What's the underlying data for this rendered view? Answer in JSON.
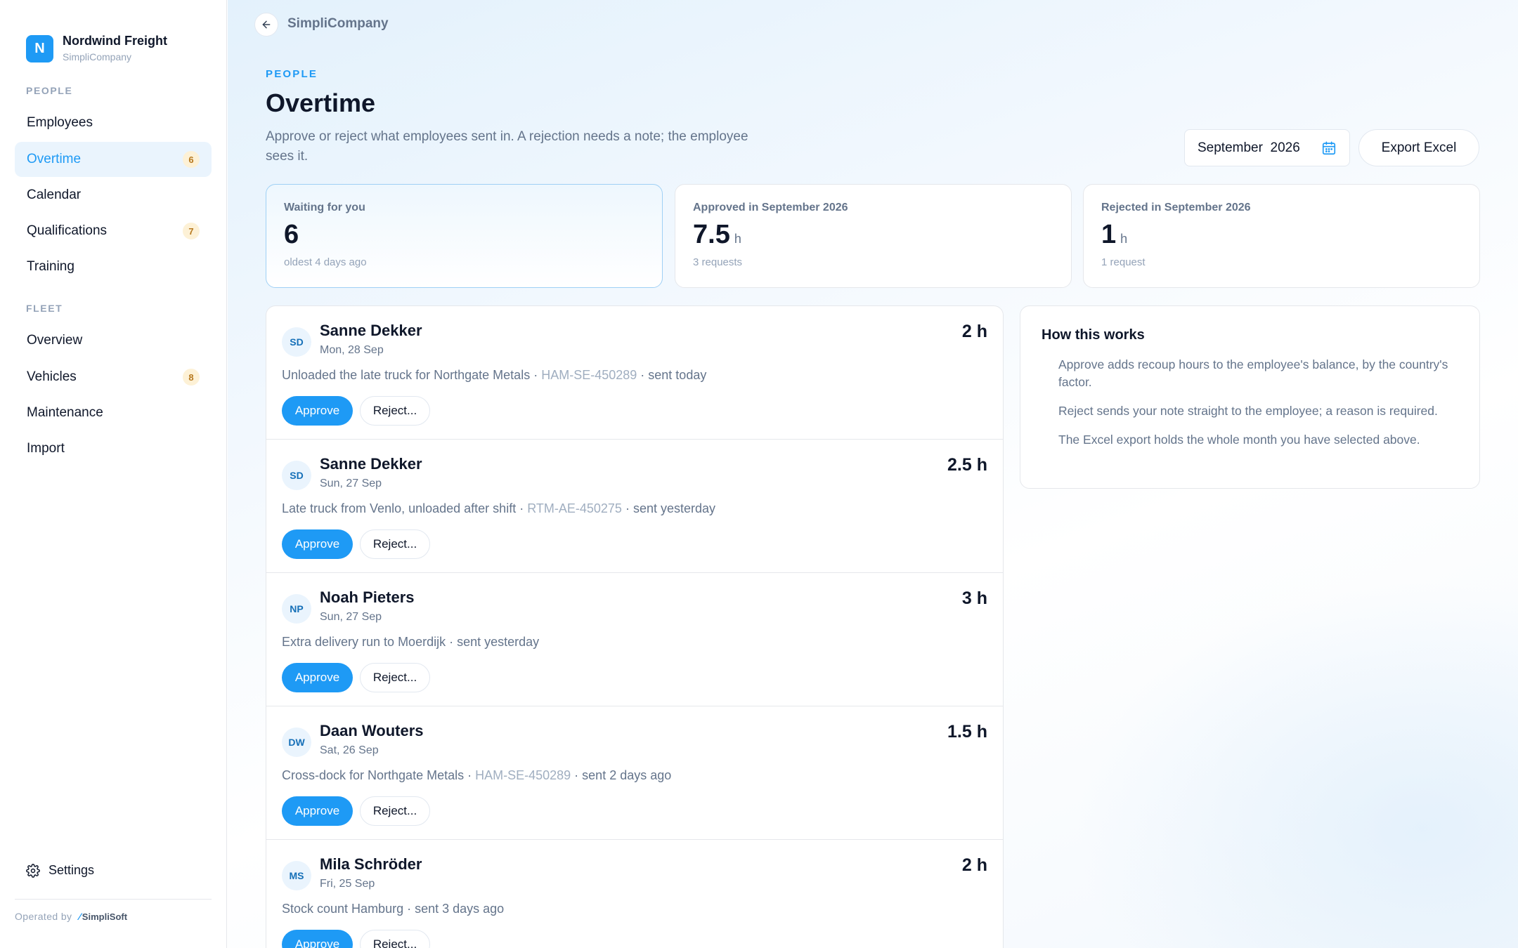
{
  "org": {
    "initial": "N",
    "name": "Nordwind Freight",
    "sub": "SimpliCompany"
  },
  "nav": {
    "people_title": "PEOPLE",
    "people": [
      {
        "label": "Employees",
        "badge": ""
      },
      {
        "label": "Overtime",
        "badge": "6"
      },
      {
        "label": "Calendar",
        "badge": ""
      },
      {
        "label": "Qualifications",
        "badge": "7"
      },
      {
        "label": "Training",
        "badge": ""
      }
    ],
    "fleet_title": "FLEET",
    "fleet": [
      {
        "label": "Overview",
        "badge": ""
      },
      {
        "label": "Vehicles",
        "badge": "8"
      },
      {
        "label": "Maintenance",
        "badge": ""
      },
      {
        "label": "Import",
        "badge": ""
      }
    ],
    "settings": "Settings",
    "operated_by": "Operated by",
    "brand": "SimpliSoft"
  },
  "header": {
    "breadcrumb": "SimpliCompany",
    "eyebrow": "PEOPLE",
    "title": "Overtime",
    "description": "Approve or reject what employees sent in. A rejection needs a note; the employee sees it.",
    "month": "September",
    "year": "2026",
    "export": "Export Excel"
  },
  "stats": [
    {
      "label": "Waiting for you",
      "value": "6",
      "unit": "",
      "note": "oldest 4 days ago"
    },
    {
      "label": "Approved in September 2026",
      "value": "7.5",
      "unit": "h",
      "note": "3 requests"
    },
    {
      "label": "Rejected in September 2026",
      "value": "1",
      "unit": "h",
      "note": "1 request"
    }
  ],
  "requests": [
    {
      "initials": "SD",
      "name": "Sanne Dekker",
      "date": "Mon, 28 Sep",
      "hours": "2 h",
      "desc": "Unloaded the late truck for Northgate Metals",
      "ref": "HAM-SE-450289",
      "sent": "sent today"
    },
    {
      "initials": "SD",
      "name": "Sanne Dekker",
      "date": "Sun, 27 Sep",
      "hours": "2.5 h",
      "desc": "Late truck from Venlo, unloaded after shift",
      "ref": "RTM-AE-450275",
      "sent": "sent yesterday"
    },
    {
      "initials": "NP",
      "name": "Noah Pieters",
      "date": "Sun, 27 Sep",
      "hours": "3 h",
      "desc": "Extra delivery run to Moerdijk",
      "ref": "",
      "sent": "sent yesterday"
    },
    {
      "initials": "DW",
      "name": "Daan Wouters",
      "date": "Sat, 26 Sep",
      "hours": "1.5 h",
      "desc": "Cross-dock for Northgate Metals",
      "ref": "HAM-SE-450289",
      "sent": "sent 2 days ago"
    },
    {
      "initials": "MS",
      "name": "Mila Schröder",
      "date": "Fri, 25 Sep",
      "hours": "2 h",
      "desc": "Stock count Hamburg",
      "ref": "",
      "sent": "sent 3 days ago"
    }
  ],
  "actions": {
    "approve": "Approve",
    "reject": "Reject..."
  },
  "separator": " · ",
  "help": {
    "title": "How this works",
    "items": [
      "Approve adds recoup hours to the employee's balance, by the country's factor.",
      "Reject sends your note straight to the employee; a reason is required.",
      "The Excel export holds the whole month you have selected above."
    ]
  },
  "colors": {
    "accent": "#1e9af5",
    "badge_bg": "#fdf1d6",
    "badge_text": "#b7791f"
  },
  "icons": {
    "back": "arrow-left-icon",
    "calendar": "calendar-icon",
    "settings": "gear-icon"
  }
}
